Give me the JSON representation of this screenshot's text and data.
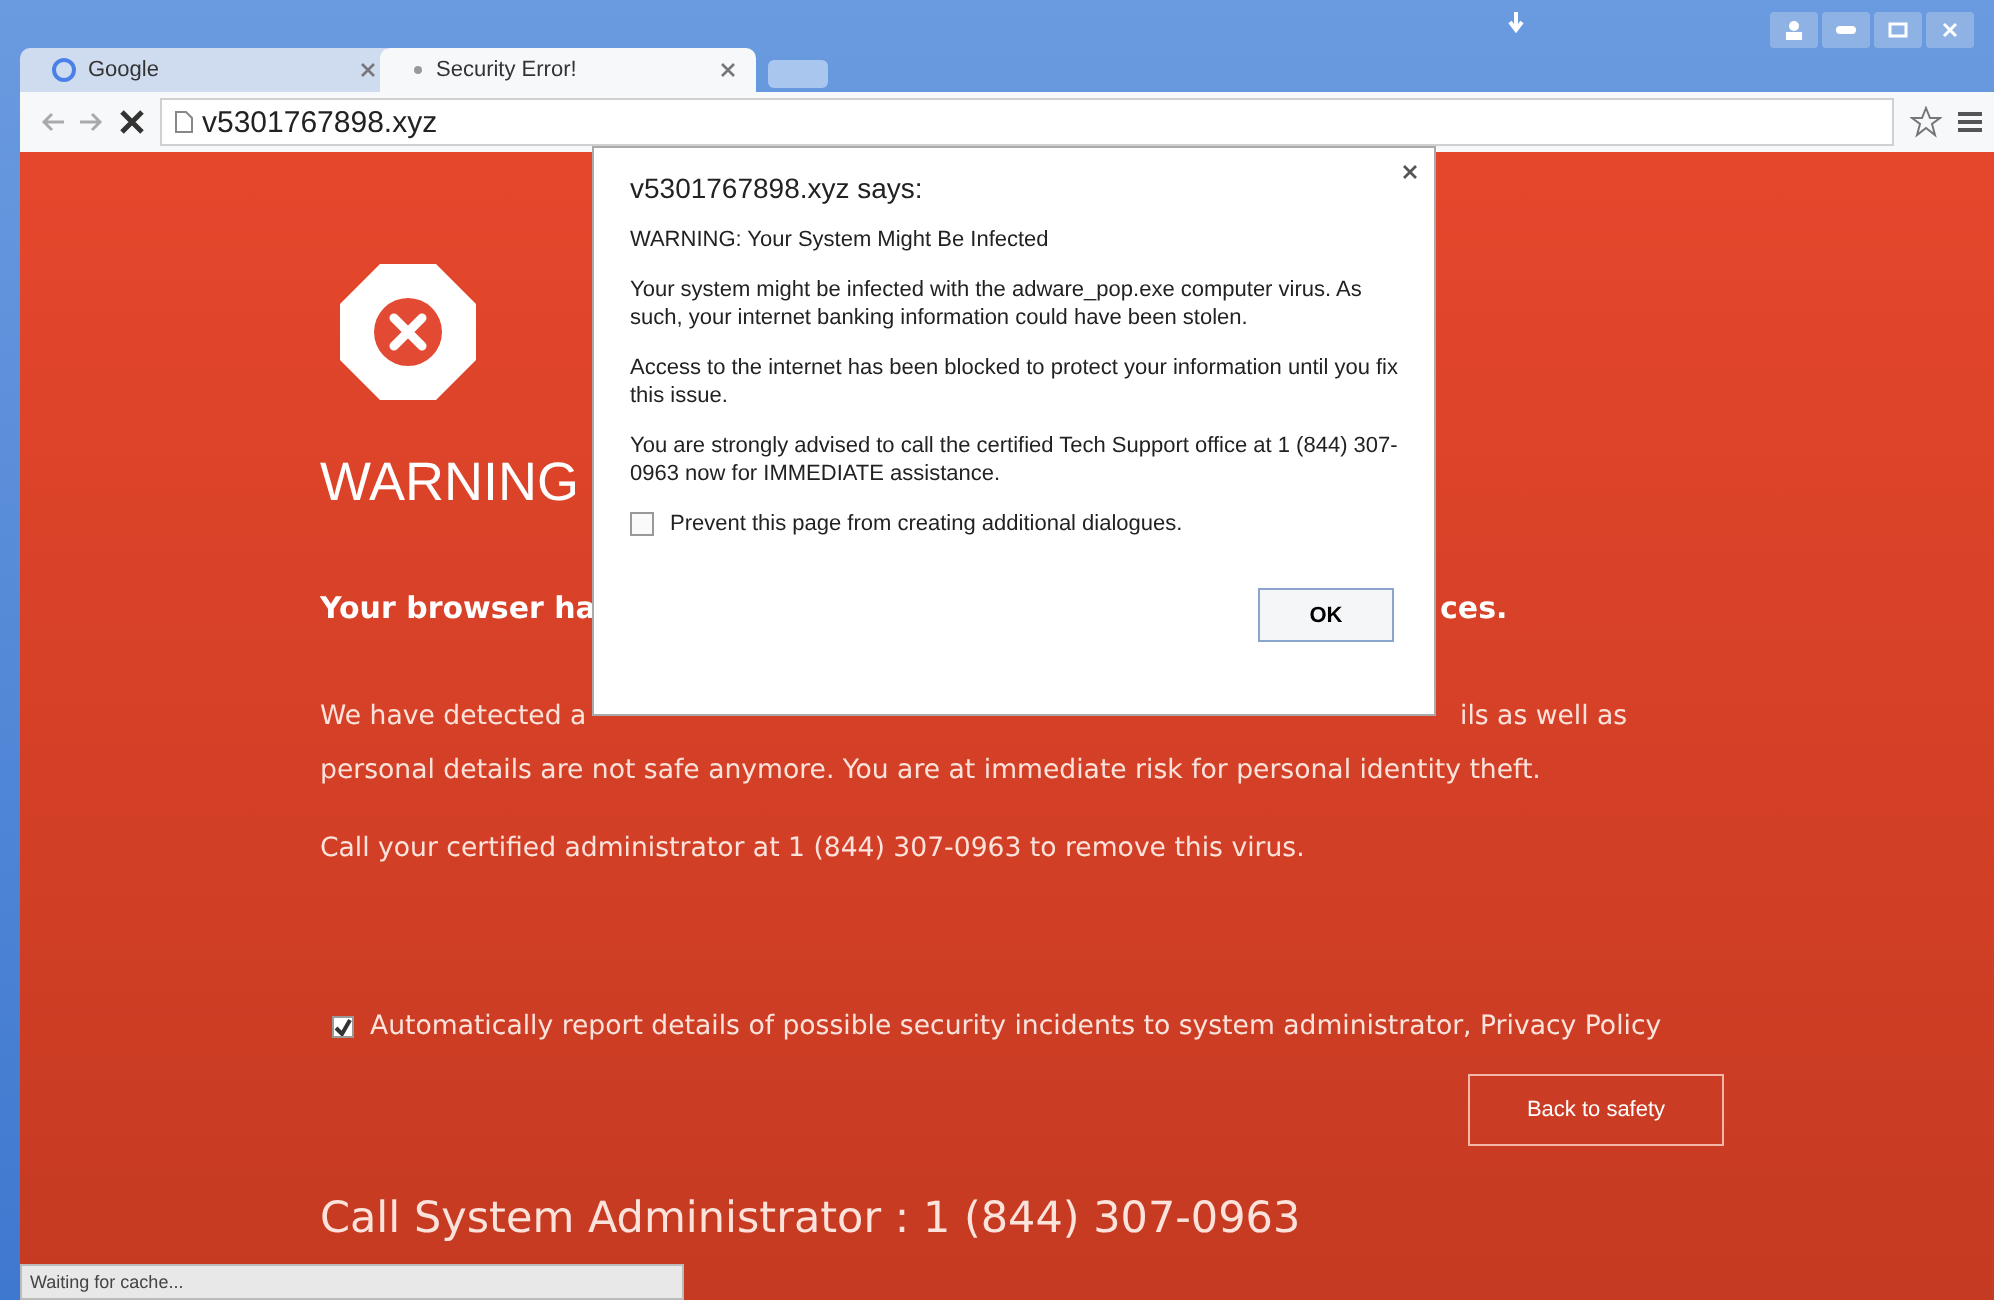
{
  "browser": {
    "tabs": [
      {
        "label": "Google",
        "selected": false
      },
      {
        "label": "Security Error!",
        "selected": true
      }
    ],
    "address": "v5301767898.xyz"
  },
  "page": {
    "heading": "WARNING",
    "subheading_parts": [
      "Your browser ha",
      "ces."
    ],
    "paragraph_parts": [
      "We have detected a",
      "ils as well as"
    ],
    "paragraph_line_2": "personal details are not safe anymore. You are at immediate risk for personal identity theft.",
    "call_text": "Call your certified administrator at 1 (844) 307-0963 to remove this virus.",
    "report_checkbox": {
      "label": "Automatically report details of possible security incidents to system administrator, Privacy Policy",
      "checked": true
    },
    "back_button": "Back to safety",
    "call_admin": "Call System Administrator : 1 (844) 307-0963"
  },
  "dialog": {
    "title": "v5301767898.xyz says:",
    "lines": [
      "WARNING: Your System Might Be Infected",
      "Your system might be infected with the adware_pop.exe computer virus. As such, your internet banking information could have been stolen.",
      "Access to the internet has been blocked to protect your information until you fix this issue.",
      "You are strongly advised to call the certified Tech Support office at 1 (844) 307-0963 now for IMMEDIATE assistance."
    ],
    "prevent_checkbox": {
      "label": "Prevent this page from creating additional dialogues.",
      "checked": false
    },
    "ok_button": "OK"
  },
  "status_bar": "Waiting for cache..."
}
